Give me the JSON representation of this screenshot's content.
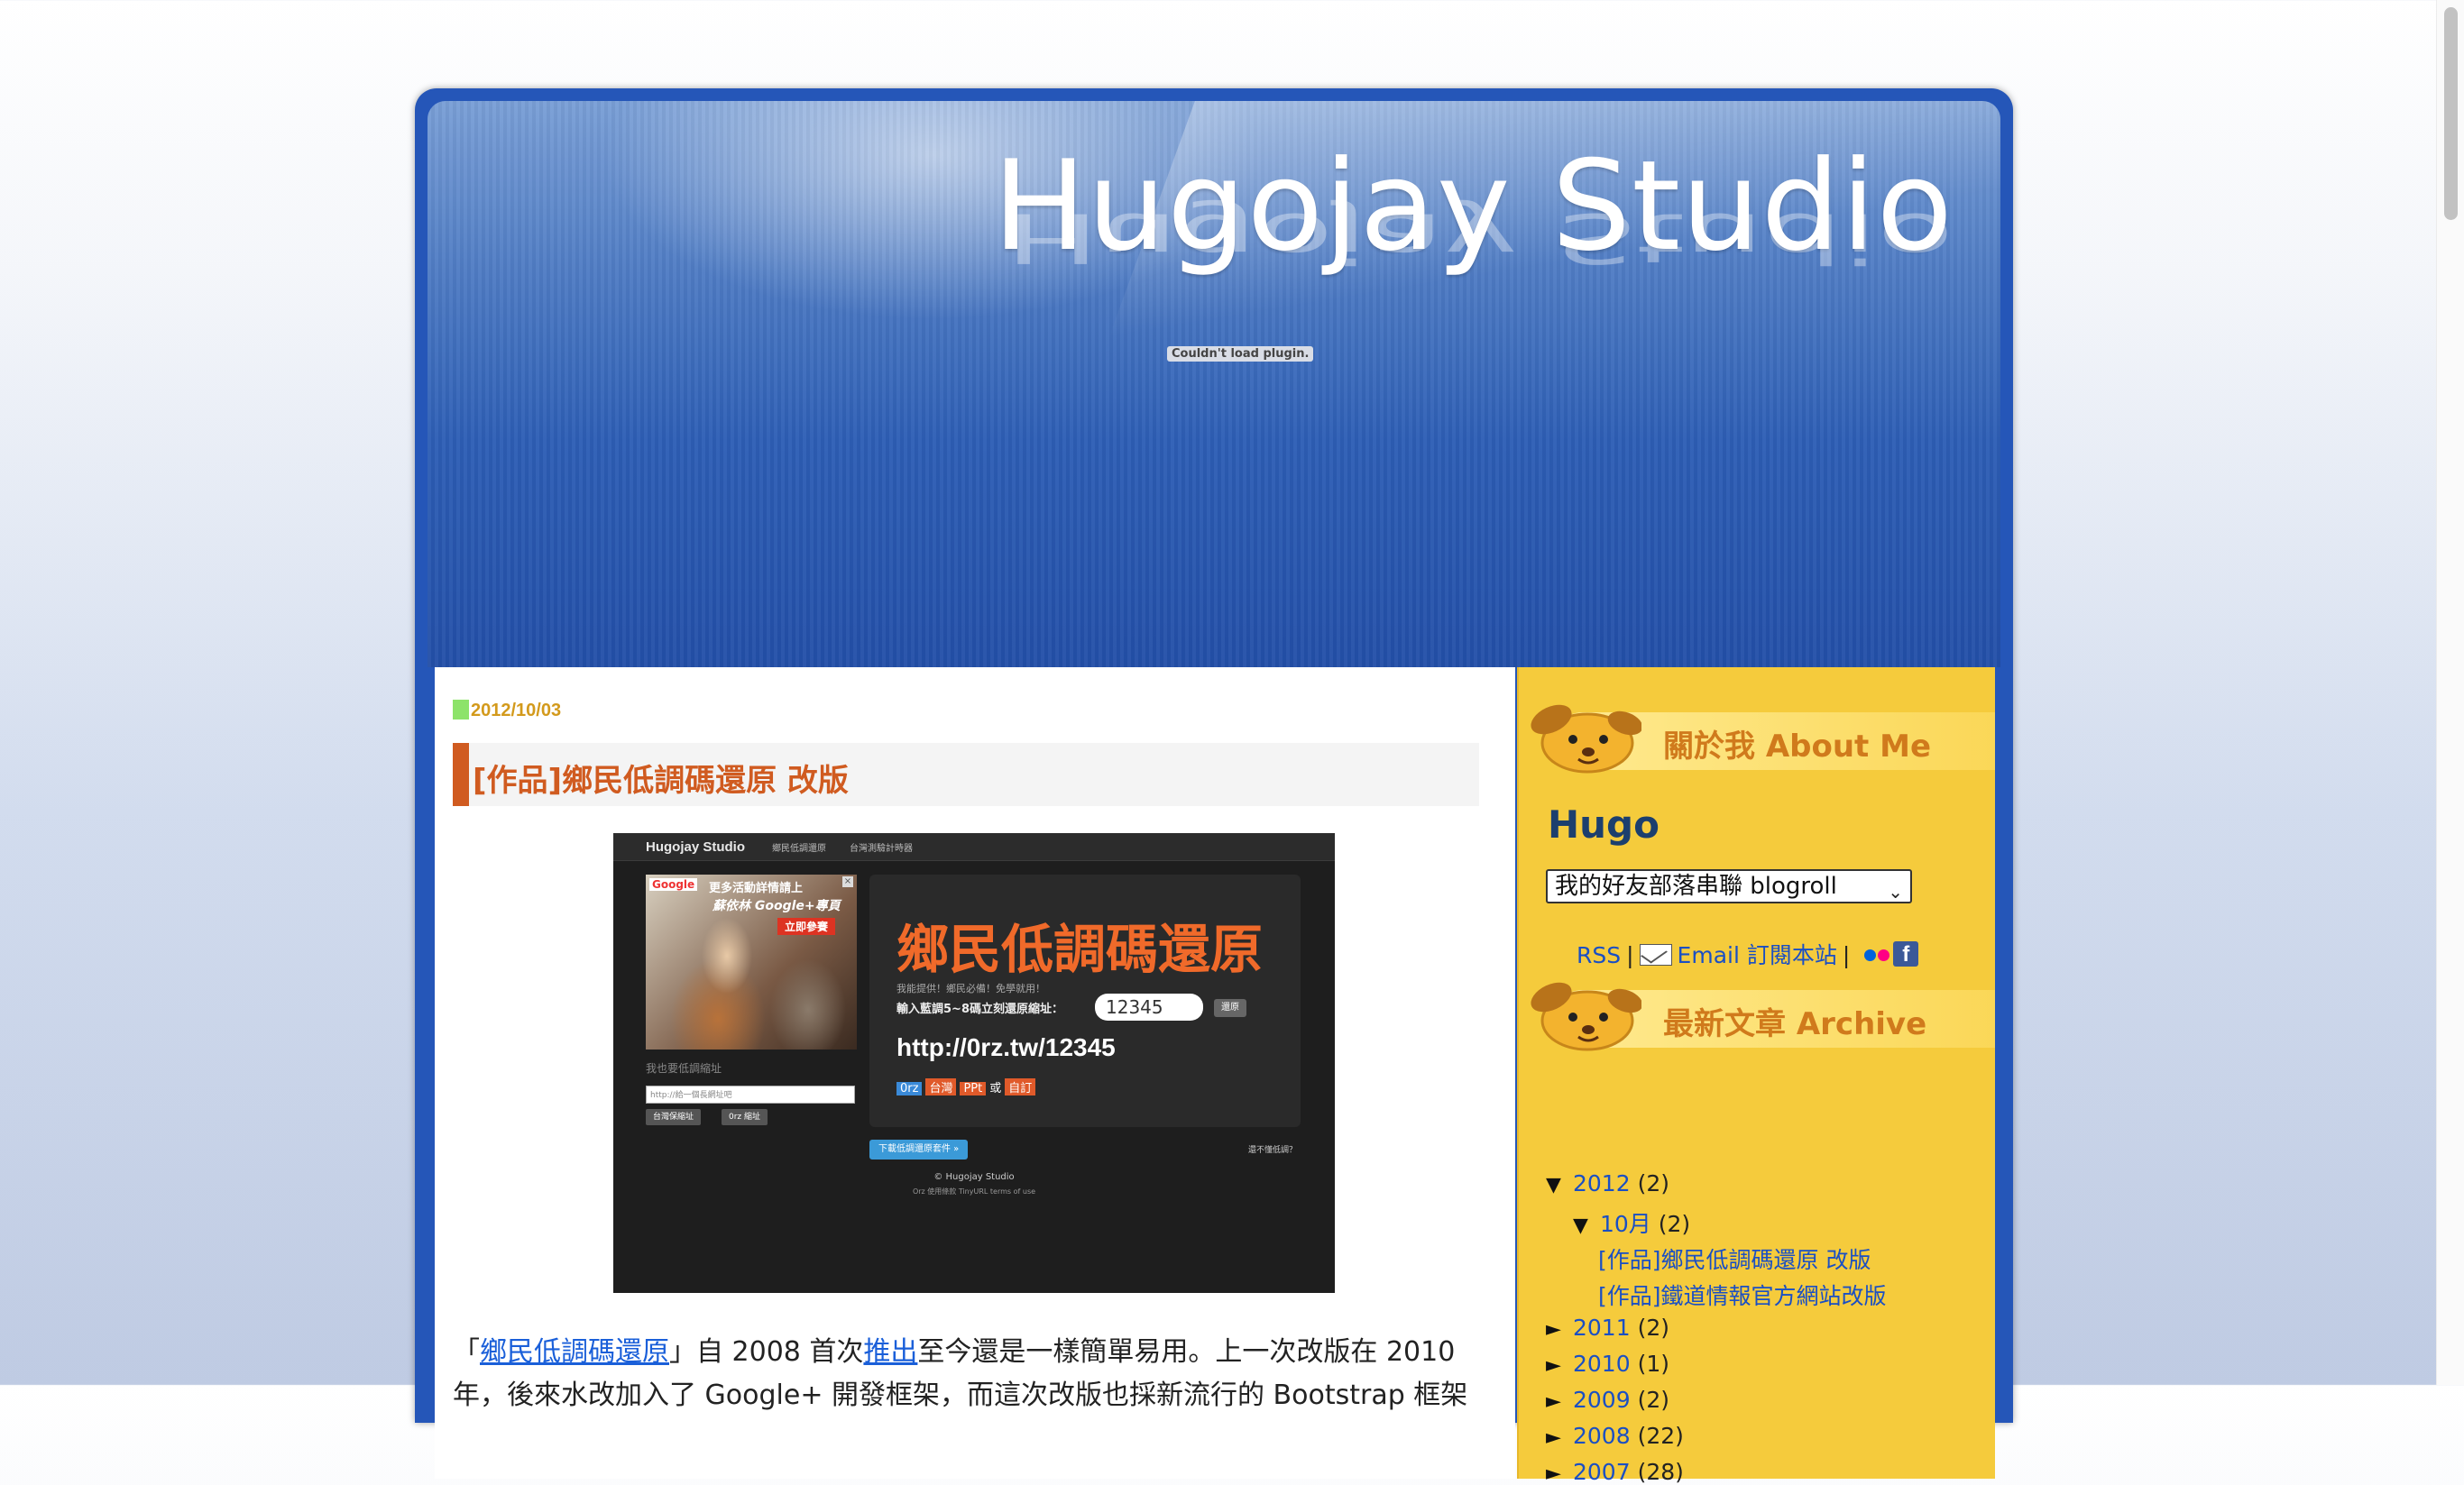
{
  "header": {
    "site_title": "Hugojay Studio",
    "plugin_message": "Couldn't load plugin."
  },
  "post": {
    "date": "2012/10/03",
    "title": "[作品]鄉民低調碼還原 改版",
    "screenshot": {
      "brand": "Hugojay Studio",
      "nav_items": [
        "鄉民低調還原",
        "台灣測驗計時器"
      ],
      "ad_logo": "Google",
      "ad_line1": "更多活動詳情請上",
      "ad_line2": "蘇依林 Google+專頁",
      "ad_button": "立即參賽",
      "also_label": "我也要低調縮址",
      "input_placeholder": "http://給一個長網址吧",
      "btn_left": "台灣保縮址",
      "btn_right": "0rz 縮址",
      "panel_title": "鄉民低調碼還原",
      "panel_sub": "我能提供！鄉民必備！免學就用！",
      "panel_prompt": "輸入藍調5~8碼立刻還原縮址：",
      "panel_input": "12345",
      "panel_go": "還原",
      "panel_url": "http://0rz.tw/12345",
      "tags": [
        "0rz",
        "台灣",
        "PPt",
        "或",
        "自訂"
      ],
      "download": "下載低調還原套件 »",
      "help": "還不懂低調？",
      "footer1": "© Hugojay Studio",
      "footer2": "Orz 使用條款 TinyURL terms of use"
    },
    "body_parts": [
      {
        "text": "「",
        "link": false
      },
      {
        "text": "鄉民低調碼還原",
        "link": true
      },
      {
        "text": "」自 2008 首次",
        "link": false
      },
      {
        "text": "推出",
        "link": true
      },
      {
        "text": "至今還是一樣簡單易用。上一次改版在 2010 年，後來水改加入了 Google+ 開發框架，而這次改版也採新流行的 Bootstrap 框架",
        "link": false
      }
    ]
  },
  "sidebar": {
    "about_title": "關於我 About Me",
    "profile_name": "Hugo",
    "blogroll_selected": "我的好友部落串聯 blogroll",
    "links": {
      "rss": "RSS",
      "separator": "|",
      "email": "Email 訂閱本站"
    },
    "archive_title": "最新文章 Archive",
    "archive": [
      {
        "expand": "▼",
        "label": "2012",
        "count": "(2)",
        "level": 0
      },
      {
        "expand": "▼",
        "label": "10月",
        "count": "(2)",
        "level": 1
      },
      {
        "expand": "",
        "label": "[作品]鄉民低調碼還原 改版",
        "count": "",
        "level": 2
      },
      {
        "expand": "",
        "label": "[作品]鐵道情報官方網站改版",
        "count": "",
        "level": 2
      },
      {
        "expand": "►",
        "label": "2011",
        "count": "(2)",
        "level": 0
      },
      {
        "expand": "►",
        "label": "2010",
        "count": "(1)",
        "level": 0
      },
      {
        "expand": "►",
        "label": "2009",
        "count": "(2)",
        "level": 0
      },
      {
        "expand": "►",
        "label": "2008",
        "count": "(22)",
        "level": 0
      },
      {
        "expand": "►",
        "label": "2007",
        "count": "(28)",
        "level": 0
      }
    ]
  },
  "colors": {
    "header_blue": "#2556b8",
    "sidebar_yellow": "#f5cb3c",
    "title_orange": "#d05b20",
    "date_gold": "#d39a1c",
    "link_blue": "#1a4fc4"
  }
}
